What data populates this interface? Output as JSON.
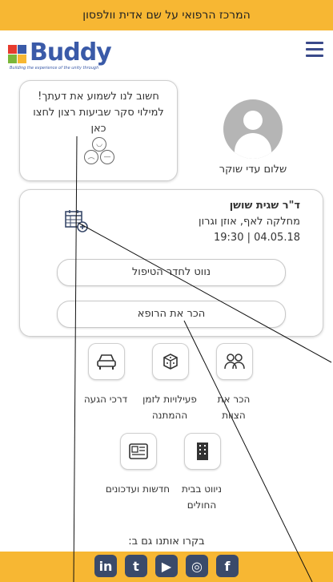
{
  "topbar": {
    "text": "המרכז הרפואי על שם אדית וולפסון"
  },
  "header": {
    "logo_text": "Buddy",
    "logo_tagline": "Building the experience of the unity through",
    "menu_icon": "hamburger-menu-icon"
  },
  "survey": {
    "text": "חשוב לנו לשמוע את דעתך! למילוי סקר שביעות רצון לחצו כאן",
    "icon": "faces-icon"
  },
  "profile": {
    "name": "שלום עדי שוקר",
    "icon": "user-avatar-icon"
  },
  "appointment": {
    "doctor": "ד\"ר שגית שושן",
    "department": "מחלקה לאף, אוזן וגרון",
    "datetime": "19:30 | 04.05.18",
    "calendar_icon": "calendar-add-icon",
    "navigate_label": "נווט לחדר הטיפול",
    "meet_doctor_label": "הכר את הרופא"
  },
  "tiles": [
    {
      "label": "הכר את הצוות",
      "icon": "team-icon"
    },
    {
      "label": "פעילויות לזמן ההמתנה",
      "icon": "dice-icon"
    },
    {
      "label": "דרכי הגעה",
      "icon": "car-icon"
    },
    {
      "label": "ניווט בבית החולים",
      "icon": "building-icon"
    },
    {
      "label": "חדשות ועדכונים",
      "icon": "newspaper-icon"
    }
  ],
  "visit_text": "בקרו אותנו גם ב:",
  "social": [
    {
      "label": "in",
      "icon": "linkedin-icon"
    },
    {
      "label": "t",
      "icon": "twitter-icon"
    },
    {
      "label": "▶",
      "icon": "youtube-icon"
    },
    {
      "label": "◎",
      "icon": "instagram-icon"
    },
    {
      "label": "f",
      "icon": "facebook-icon"
    }
  ],
  "colors": {
    "accent": "#f7b733",
    "brand": "#3a5aa8",
    "social_bg": "#3a4a6a"
  }
}
